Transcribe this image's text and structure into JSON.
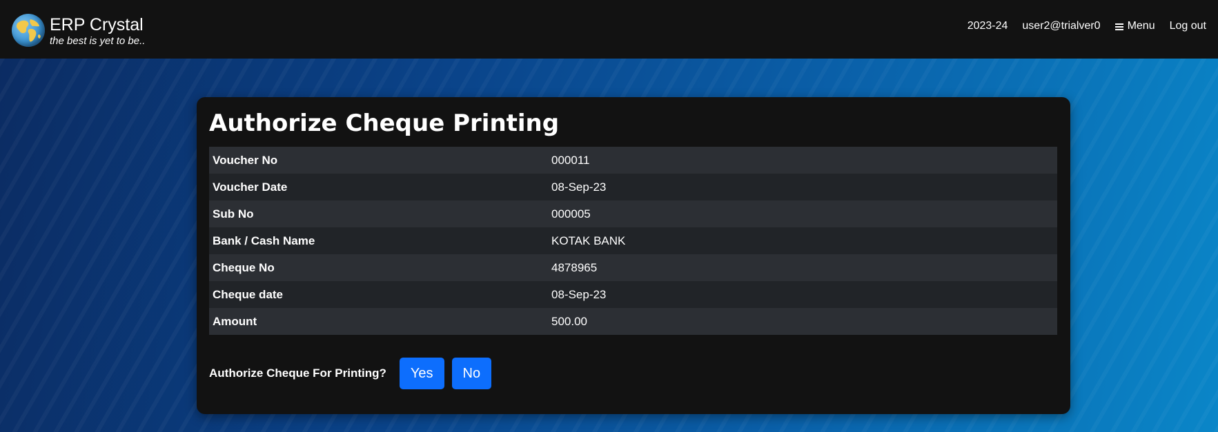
{
  "header": {
    "brand_name": "ERP Crystal",
    "tagline": "the best is yet to be..",
    "fiscal_year": "2023-24",
    "user": "user2@trialver0",
    "menu_label": "Menu",
    "logout_label": "Log out",
    "logo_icon": "globe-icon",
    "menu_icon": "hamburger-icon"
  },
  "card": {
    "title": "Authorize Cheque Printing",
    "fields": [
      {
        "label": "Voucher No",
        "value": "000011"
      },
      {
        "label": "Voucher Date",
        "value": "08-Sep-23"
      },
      {
        "label": "Sub No",
        "value": "000005"
      },
      {
        "label": "Bank / Cash Name",
        "value": "KOTAK BANK"
      },
      {
        "label": "Cheque No",
        "value": "4878965"
      },
      {
        "label": "Cheque date",
        "value": "08-Sep-23"
      },
      {
        "label": "Amount",
        "value": "500.00"
      }
    ],
    "authorize_prompt": "Authorize Cheque For Printing?",
    "yes_label": "Yes",
    "no_label": "No"
  },
  "colors": {
    "navbar_bg": "#121212",
    "card_bg": "#121212",
    "button_primary": "#0d6efd",
    "row_odd": "#2c2f34",
    "row_even": "#212428"
  }
}
